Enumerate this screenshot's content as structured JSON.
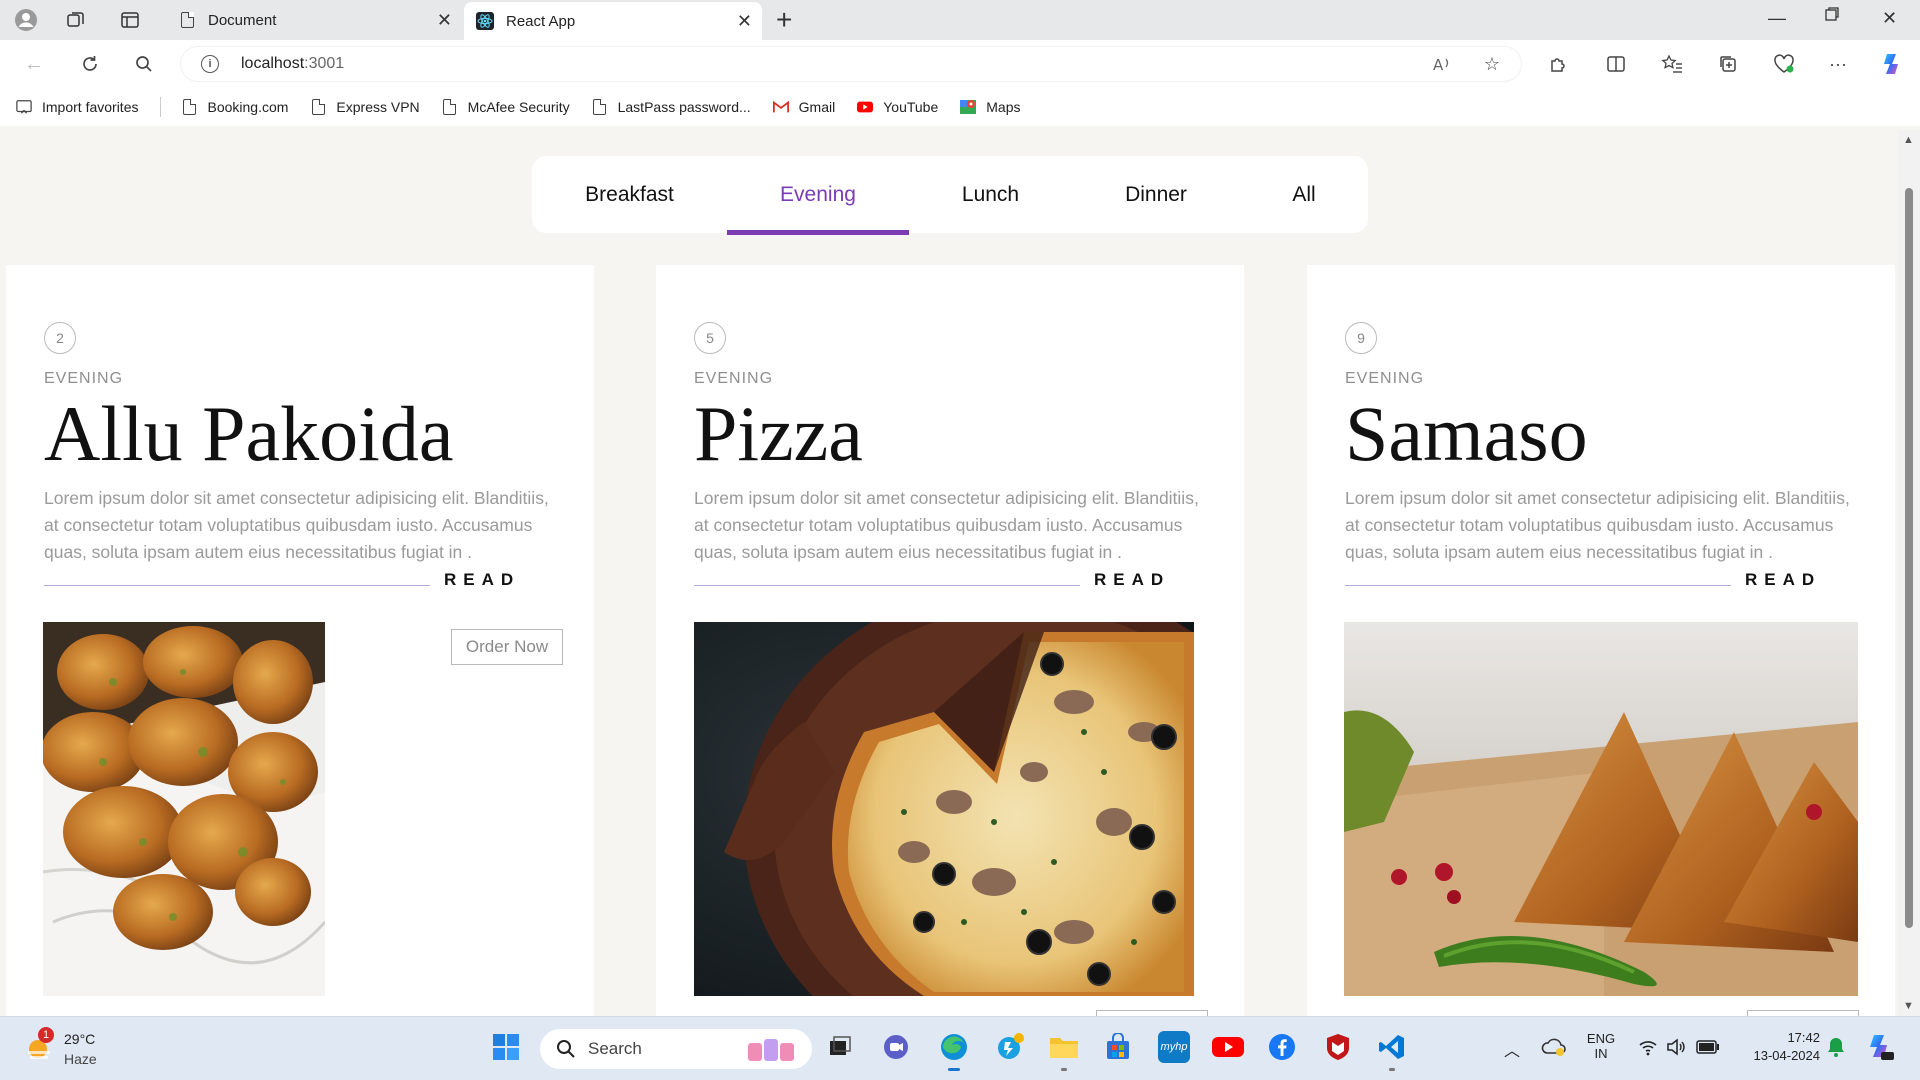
{
  "browser": {
    "tabs": [
      {
        "title": "Document",
        "active": false
      },
      {
        "title": "React App",
        "active": true
      }
    ],
    "url_host": "localhost",
    "url_port": ":3001",
    "favorites": [
      "Import favorites",
      "Booking.com",
      "Express VPN",
      "McAfee Security",
      "LastPass password...",
      "Gmail",
      "YouTube",
      "Maps"
    ]
  },
  "menu": {
    "items": [
      "Breakfast",
      "Evening",
      "Lunch",
      "Dinner",
      "All"
    ],
    "active": "Evening"
  },
  "cards": [
    {
      "number": "2",
      "category": "EVENING",
      "title": "Allu Pakoida",
      "description": "Lorem ipsum dolor sit amet consectetur adipisicing elit. Blanditiis, at consectetur totam voluptatibus quibusdam iusto. Accusamus quas, soluta ipsam autem eius necessitatibus fugiat in .",
      "read_label": "READ",
      "order_label": "Order Now"
    },
    {
      "number": "5",
      "category": "EVENING",
      "title": "Pizza",
      "description": "Lorem ipsum dolor sit amet consectetur adipisicing elit. Blanditiis, at consectetur totam voluptatibus quibusdam iusto. Accusamus quas, soluta ipsam autem eius necessitatibus fugiat in .",
      "read_label": "READ",
      "order_label": ""
    },
    {
      "number": "9",
      "category": "EVENING",
      "title": "Samaso",
      "description": "Lorem ipsum dolor sit amet consectetur adipisicing elit. Blanditiis, at consectetur totam voluptatibus quibusdam iusto. Accusamus quas, soluta ipsam autem eius necessitatibus fugiat in .",
      "read_label": "READ",
      "order_label": ""
    }
  ],
  "taskbar": {
    "weather_temp": "29°C",
    "weather_desc": "Haze",
    "weather_badge": "1",
    "search_label": "Search",
    "lang_top": "ENG",
    "lang_bottom": "IN",
    "time": "17:42",
    "date": "13-04-2024"
  },
  "colors": {
    "accent": "#7b3bb3",
    "page_bg": "#f7f5f1",
    "card_bg": "#ffffff",
    "muted_text": "#9a9a9a"
  }
}
